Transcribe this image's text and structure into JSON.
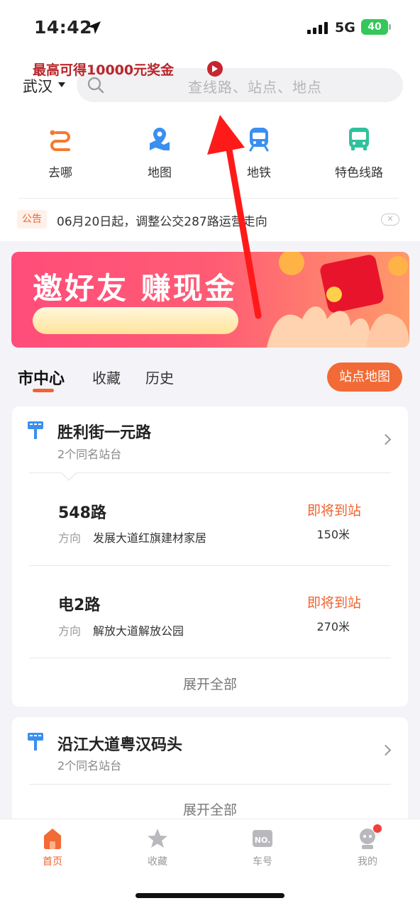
{
  "status_bar": {
    "time": "14:42",
    "network": "5G",
    "battery": "40"
  },
  "header": {
    "city": "武汉",
    "search_placeholder": "查线路、站点、地点"
  },
  "quick_nav": [
    {
      "label": "去哪",
      "icon": "route-icon",
      "color": "#f57a2f"
    },
    {
      "label": "地图",
      "icon": "map-pin-icon",
      "color": "#3a8ff0"
    },
    {
      "label": "地铁",
      "icon": "metro-icon",
      "color": "#3a8ff0"
    },
    {
      "label": "特色线路",
      "icon": "bus-icon",
      "color": "#2fc29b"
    }
  ],
  "notice": {
    "tag": "公告",
    "text": "06月20日起，调整公交287路运营走向"
  },
  "banner": {
    "title": "邀好友 赚现金",
    "cta": "最高可得10000元奖金"
  },
  "tabs": {
    "items": [
      "市中心",
      "收藏",
      "历史"
    ],
    "active": 0,
    "map_button": "站点地图"
  },
  "stations": [
    {
      "name": "胜利街一元路",
      "sub": "2个同名站台",
      "routes": [
        {
          "name": "548路",
          "dir_label": "方向",
          "direction": "发展大道红旗建材家居",
          "status": "即将到站",
          "distance": "150米"
        },
        {
          "name": "电2路",
          "dir_label": "方向",
          "direction": "解放大道解放公园",
          "status": "即将到站",
          "distance": "270米"
        }
      ],
      "expand": "展开全部"
    },
    {
      "name": "沿江大道粤汉码头",
      "sub": "2个同名站台",
      "routes": [],
      "expand": "展开全部"
    }
  ],
  "bottom_nav": [
    {
      "label": "首页",
      "icon": "home-icon",
      "active": true
    },
    {
      "label": "收藏",
      "icon": "star-icon",
      "active": false
    },
    {
      "label": "车号",
      "icon": "bus-number-icon",
      "active": false
    },
    {
      "label": "我的",
      "icon": "profile-icon",
      "active": false
    }
  ],
  "colors": {
    "accent": "#f2622e",
    "annotation": "#ff1a1a"
  }
}
